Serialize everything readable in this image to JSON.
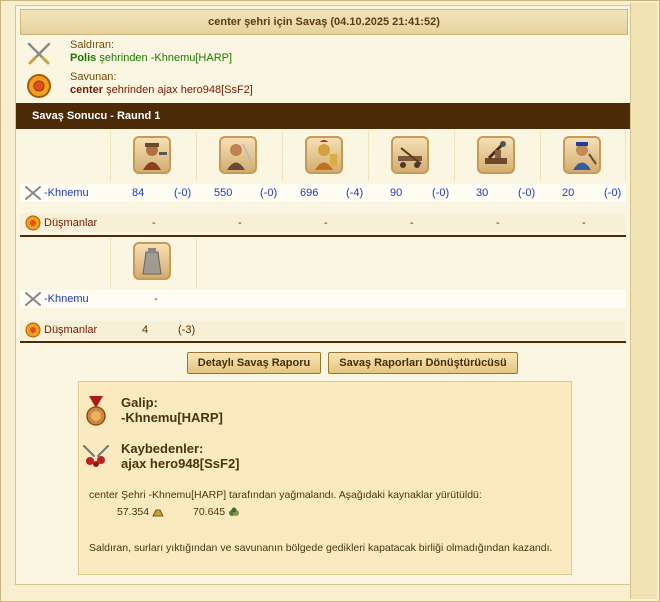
{
  "title": "center şehri için Savaş (04.10.2025 21:41:52)",
  "attacker": {
    "label": "Saldıran:",
    "player": "Polis",
    "city_text": "şehrinden -Khnemu[HARP]"
  },
  "defender": {
    "label": "Savunan:",
    "player": "center",
    "city_text": "şehrinden ajax hero948[SsF2]"
  },
  "round_title": "Savaş Sonucu - Raund 1",
  "land": {
    "attacker_name": "-Khnemu",
    "defender_name": "Düşmanlar",
    "units": [
      {
        "icon": "soldier-unit-icon",
        "count": "84",
        "loss": "(-0)",
        "enemy": "-"
      },
      {
        "icon": "swordsman-unit-icon",
        "count": "550",
        "loss": "(-0)",
        "enemy": "-"
      },
      {
        "icon": "hoplite-unit-icon",
        "count": "696",
        "loss": "(-4)",
        "enemy": "-"
      },
      {
        "icon": "ballista-unit-icon",
        "count": "90",
        "loss": "(-0)",
        "enemy": "-"
      },
      {
        "icon": "catapult-unit-icon",
        "count": "30",
        "loss": "(-0)",
        "enemy": "-"
      },
      {
        "icon": "gunner-unit-icon",
        "count": "20",
        "loss": "(-0)",
        "enemy": "-"
      }
    ]
  },
  "wall": {
    "attacker_name": "-Khnemu",
    "defender_name": "Düşmanlar",
    "icon": "wall-unit-icon",
    "attacker_value": "-",
    "defender_count": "4",
    "defender_loss": "(-3)"
  },
  "buttons": {
    "detailed": "Detaylı Savaş Raporu",
    "converter": "Savaş Raporları Dönüştürücüsü"
  },
  "result": {
    "winner_label": "Galip:",
    "winner": "-Khnemu[HARP]",
    "loser_label": "Kaybedenler:",
    "loser": "ajax hero948[SsF2]",
    "plunder_text": "center Şehri -Khnemu[HARP] tarafından yağmalandı. Aşağıdaki kaynaklar yürütüldü:",
    "gold": "57.354",
    "goods": "70.645",
    "note": "Saldıran, surları yıktığından ve savunanın bölgede gedikleri kapatacak birliği olmadığından kazandı."
  }
}
